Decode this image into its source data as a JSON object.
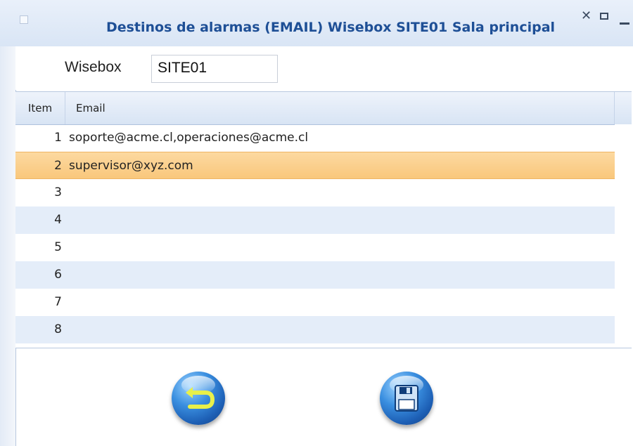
{
  "window": {
    "title": "Destinos de alarmas (EMAIL) Wisebox SITE01 Sala principal",
    "controls": [
      "close-icon",
      "maximize-icon",
      "minimize-icon"
    ]
  },
  "form": {
    "wisebox_label": "Wisebox",
    "wisebox_value": "SITE01"
  },
  "grid": {
    "columns": [
      "Item",
      "Email"
    ],
    "rows": [
      {
        "item": "1",
        "email": "soporte@acme.cl,operaciones@acme.cl"
      },
      {
        "item": "2",
        "email": "supervisor@xyz.com"
      },
      {
        "item": "3",
        "email": ""
      },
      {
        "item": "4",
        "email": ""
      },
      {
        "item": "5",
        "email": ""
      },
      {
        "item": "6",
        "email": ""
      },
      {
        "item": "7",
        "email": ""
      },
      {
        "item": "8",
        "email": ""
      }
    ],
    "selected_row": "2"
  },
  "buttons": {
    "back_icon": "undo-arrow-icon",
    "save_icon": "floppy-disk-icon"
  },
  "colors": {
    "title": "#1e4f96",
    "selected_row": "#f9c77c",
    "alt_row": "#e4edf9",
    "button_blue": "#1d5fb5"
  }
}
